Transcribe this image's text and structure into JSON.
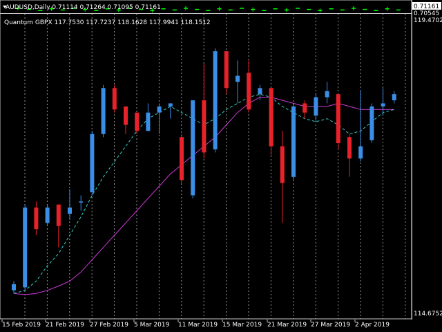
{
  "colors": {
    "background": "#000000",
    "bull": "#3a8ee6",
    "bear": "#e8222a",
    "ma_fast": "#38d0c8",
    "ma_slow": "#d038d8",
    "grid": "#c8c8c8",
    "main_chart_symbol": "#00ff00",
    "text": "#ffffff"
  },
  "top_window": {
    "title": "AUDUSD,Daily 0.71114 0.71264 0.71095 0.71161",
    "price_tag": "0.71161",
    "price_below": "0.70545"
  },
  "indicator_window": {
    "title": "Quantum GBPX 117.7530 117.7237 118.1628 117.9941 118.1512",
    "price_high_label": "119.4702",
    "price_low_label": "114.6752"
  },
  "x_axis": {
    "labels": [
      "15 Feb 2019",
      "21 Feb 2019",
      "27 Feb 2019",
      "5 Mar 2019",
      "11 Mar 2019",
      "15 Mar 2019",
      "21 Mar 2019",
      "27 Mar 2019",
      "2 Apr 2019"
    ]
  },
  "chart_data": {
    "type": "candlestick",
    "y_range": [
      114.6752,
      119.4702
    ],
    "candles": [
      {
        "o": 115.05,
        "h": 115.2,
        "l": 115.0,
        "c": 115.15
      },
      {
        "o": 115.1,
        "h": 116.45,
        "l": 115.05,
        "c": 116.4
      },
      {
        "o": 116.4,
        "h": 116.5,
        "l": 115.95,
        "c": 116.05
      },
      {
        "o": 116.15,
        "h": 116.45,
        "l": 116.1,
        "c": 116.4
      },
      {
        "o": 116.45,
        "h": 116.45,
        "l": 115.75,
        "c": 116.1
      },
      {
        "o": 116.3,
        "h": 116.7,
        "l": 116.2,
        "c": 116.4
      },
      {
        "o": 116.5,
        "h": 116.6,
        "l": 116.35,
        "c": 116.5
      },
      {
        "o": 116.65,
        "h": 117.65,
        "l": 116.6,
        "c": 117.6
      },
      {
        "o": 117.6,
        "h": 118.4,
        "l": 117.55,
        "c": 118.35
      },
      {
        "o": 118.35,
        "h": 118.4,
        "l": 117.95,
        "c": 118.0
      },
      {
        "o": 118.05,
        "h": 118.05,
        "l": 117.6,
        "c": 117.75
      },
      {
        "o": 117.95,
        "h": 117.95,
        "l": 117.6,
        "c": 117.65
      },
      {
        "o": 117.65,
        "h": 118.1,
        "l": 117.65,
        "c": 117.95
      },
      {
        "o": 117.95,
        "h": 118.1,
        "l": 117.6,
        "c": 118.05
      },
      {
        "o": 118.05,
        "h": 118.1,
        "l": 117.85,
        "c": 118.1
      },
      {
        "o": 117.55,
        "h": 117.6,
        "l": 116.8,
        "c": 116.85
      },
      {
        "o": 116.6,
        "h": 118.15,
        "l": 116.55,
        "c": 118.15
      },
      {
        "o": 118.15,
        "h": 118.75,
        "l": 117.2,
        "c": 117.3
      },
      {
        "o": 117.35,
        "h": 119.0,
        "l": 117.3,
        "c": 118.95
      },
      {
        "o": 118.95,
        "h": 118.95,
        "l": 118.25,
        "c": 118.35
      },
      {
        "o": 118.45,
        "h": 118.8,
        "l": 118.1,
        "c": 118.55
      },
      {
        "o": 118.6,
        "h": 118.8,
        "l": 117.95,
        "c": 118.0
      },
      {
        "o": 118.25,
        "h": 118.4,
        "l": 118.15,
        "c": 118.35
      },
      {
        "o": 118.35,
        "h": 118.35,
        "l": 117.25,
        "c": 117.4
      },
      {
        "o": 117.4,
        "h": 117.65,
        "l": 116.15,
        "c": 116.8
      },
      {
        "o": 116.9,
        "h": 118.1,
        "l": 116.85,
        "c": 118.05
      },
      {
        "o": 118.1,
        "h": 118.15,
        "l": 117.85,
        "c": 117.95
      },
      {
        "o": 117.9,
        "h": 118.25,
        "l": 117.8,
        "c": 118.2
      },
      {
        "o": 118.2,
        "h": 118.45,
        "l": 118.1,
        "c": 118.3
      },
      {
        "o": 118.25,
        "h": 118.25,
        "l": 117.35,
        "c": 117.45
      },
      {
        "o": 117.55,
        "h": 117.6,
        "l": 116.9,
        "c": 117.2
      },
      {
        "o": 117.2,
        "h": 118.3,
        "l": 117.15,
        "c": 117.4
      },
      {
        "o": 117.5,
        "h": 118.1,
        "l": 117.45,
        "c": 118.05
      },
      {
        "o": 118.05,
        "h": 118.35,
        "l": 117.9,
        "c": 118.1
      },
      {
        "o": 118.15,
        "h": 118.3,
        "l": 118.1,
        "c": 118.25
      }
    ],
    "ma_fast": [
      115.0,
      115.05,
      115.2,
      115.45,
      115.65,
      115.95,
      116.25,
      116.6,
      116.9,
      117.15,
      117.4,
      117.65,
      117.85,
      117.95,
      118.05,
      117.95,
      117.85,
      117.75,
      117.85,
      118.0,
      118.1,
      118.2,
      118.25,
      118.2,
      118.05,
      117.95,
      117.85,
      117.8,
      117.85,
      117.75,
      117.6,
      117.65,
      117.8,
      117.95,
      118.0
    ],
    "ma_slow": [
      115.0,
      114.98,
      115.0,
      115.05,
      115.12,
      115.2,
      115.35,
      115.55,
      115.75,
      115.95,
      116.15,
      116.35,
      116.55,
      116.75,
      116.95,
      117.1,
      117.25,
      117.4,
      117.55,
      117.75,
      117.95,
      118.1,
      118.2,
      118.2,
      118.15,
      118.1,
      118.05,
      118.05,
      118.05,
      118.1,
      118.05,
      118.0,
      118.0,
      118.0,
      118.0
    ]
  }
}
